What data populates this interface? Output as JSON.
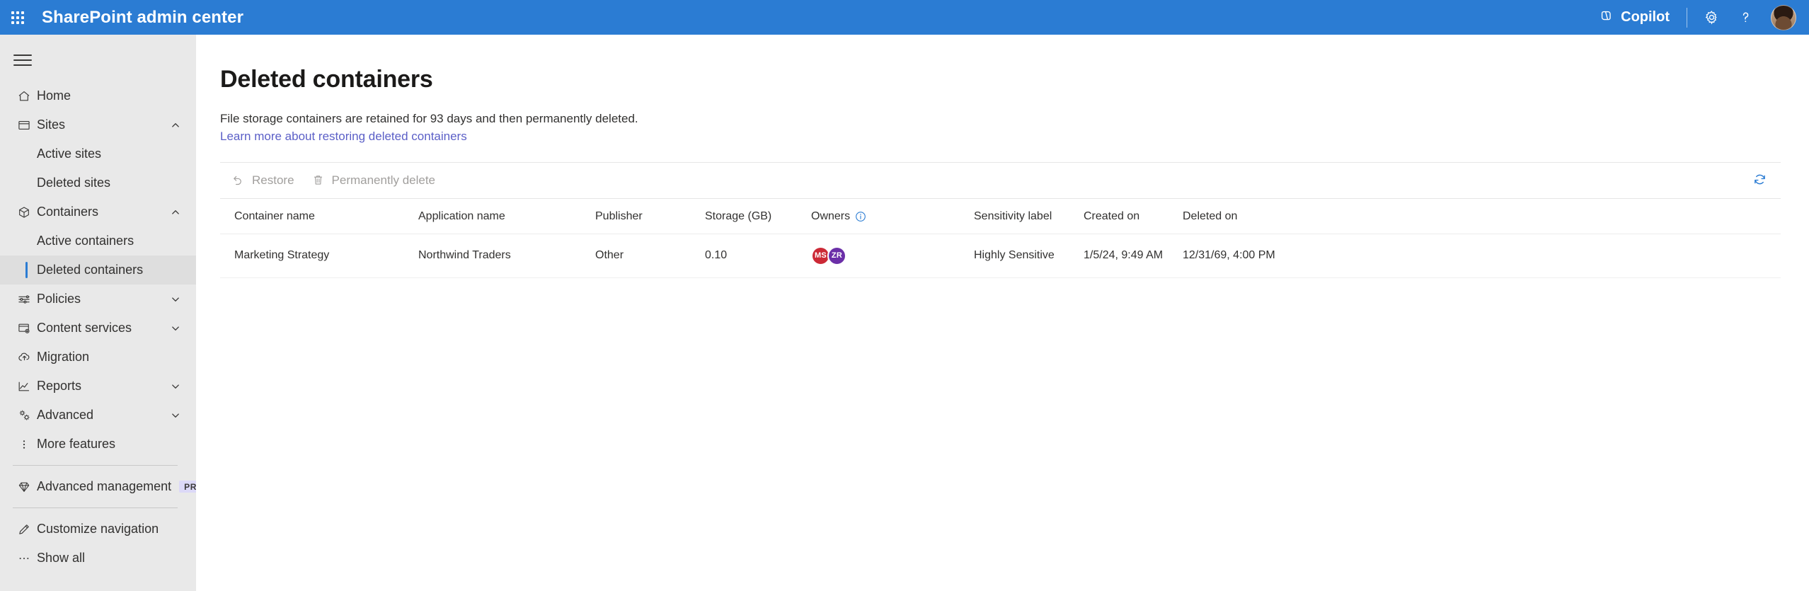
{
  "suite": {
    "waffle_icon": "app-launcher-icon",
    "title": "SharePoint admin center",
    "copilot_label": "Copilot",
    "copilot_icon": "copilot-icon",
    "settings_icon": "gear-icon",
    "help_icon": "question-mark-icon",
    "avatar_icon": "user-avatar",
    "accent": "#2b7cd3"
  },
  "sidebar": {
    "menu_toggle_icon": "hamburger-menu-icon",
    "items": [
      {
        "label": "Home",
        "icon": "home-icon",
        "type": "item",
        "expandable": false
      },
      {
        "label": "Sites",
        "icon": "sites-icon",
        "type": "item",
        "expandable": true,
        "expanded": true
      },
      {
        "label": "Active sites",
        "type": "sub",
        "selected": false
      },
      {
        "label": "Deleted sites",
        "type": "sub",
        "selected": false
      },
      {
        "label": "Containers",
        "icon": "container-box-icon",
        "type": "item",
        "expandable": true,
        "expanded": true
      },
      {
        "label": "Active containers",
        "type": "sub",
        "selected": false
      },
      {
        "label": "Deleted containers",
        "type": "sub",
        "selected": true
      },
      {
        "label": "Policies",
        "icon": "sliders-icon",
        "type": "item",
        "expandable": true,
        "expanded": false
      },
      {
        "label": "Content services",
        "icon": "content-services-icon",
        "type": "item",
        "expandable": true,
        "expanded": false
      },
      {
        "label": "Migration",
        "icon": "cloud-upload-icon",
        "type": "item",
        "expandable": false
      },
      {
        "label": "Reports",
        "icon": "chart-line-icon",
        "type": "item",
        "expandable": true,
        "expanded": false
      },
      {
        "label": "Advanced",
        "icon": "advanced-gears-icon",
        "type": "item",
        "expandable": true,
        "expanded": false
      },
      {
        "label": "More features",
        "icon": "more-vertical-icon",
        "type": "item",
        "expandable": false
      }
    ],
    "advanced_management": {
      "label": "Advanced management",
      "icon": "diamond-icon",
      "badge": "PRO"
    },
    "customize_navigation": {
      "label": "Customize navigation",
      "icon": "pencil-icon"
    },
    "show_all": {
      "label": "Show all",
      "icon": "ellipsis-icon"
    }
  },
  "main": {
    "title": "Deleted containers",
    "description": "File storage containers are retained for 93 days and then permanently deleted.",
    "learn_more": "Learn more about restoring deleted containers"
  },
  "commandbar": {
    "restore_label": "Restore",
    "restore_icon": "undo-arrow-icon",
    "delete_label": "Permanently delete",
    "delete_icon": "trash-icon",
    "refresh_icon": "refresh-icon"
  },
  "table": {
    "columns": [
      {
        "key": "container_name",
        "label": "Container name"
      },
      {
        "key": "application_name",
        "label": "Application name"
      },
      {
        "key": "publisher",
        "label": "Publisher"
      },
      {
        "key": "storage_gb",
        "label": "Storage (GB)"
      },
      {
        "key": "owners",
        "label": "Owners",
        "info_icon": "info-icon"
      },
      {
        "key": "sensitivity_label",
        "label": "Sensitivity label"
      },
      {
        "key": "created_on",
        "label": "Created on"
      },
      {
        "key": "deleted_on",
        "label": "Deleted on"
      }
    ],
    "rows": [
      {
        "container_name": "Marketing Strategy",
        "application_name": "Northwind Traders",
        "publisher": "Other",
        "storage_gb": "0.10",
        "owners": [
          {
            "initials": "MS",
            "color": "#cc2936"
          },
          {
            "initials": "ZR",
            "color": "#6b2fa8"
          }
        ],
        "sensitivity_label": "Highly Sensitive",
        "created_on": "1/5/24, 9:49 AM",
        "deleted_on": "12/31/69, 4:00 PM"
      }
    ]
  }
}
